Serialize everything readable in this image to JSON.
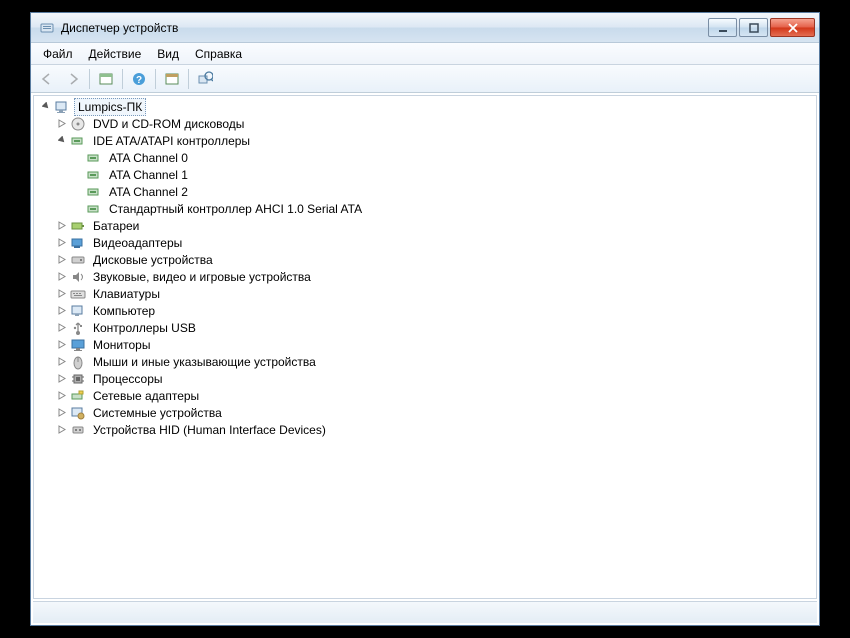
{
  "window": {
    "title": "Диспетчер устройств"
  },
  "menu": {
    "file": "Файл",
    "action": "Действие",
    "view": "Вид",
    "help": "Справка"
  },
  "tree": {
    "root": "Lumpics-ПК",
    "dvd": "DVD и CD-ROM дисководы",
    "ide": "IDE ATA/ATAPI контроллеры",
    "ide_children": {
      "ch0": "ATA Channel 0",
      "ch1": "ATA Channel 1",
      "ch2": "ATA Channel 2",
      "ahci": "Стандартный контроллер AHCI 1.0 Serial ATA"
    },
    "battery": "Батареи",
    "video": "Видеоадаптеры",
    "disk": "Дисковые устройства",
    "sound": "Звуковые, видео и игровые устройства",
    "keyboard": "Клавиатуры",
    "computer": "Компьютер",
    "usb": "Контроллеры USB",
    "monitor": "Мониторы",
    "mouse": "Мыши и иные указывающие устройства",
    "cpu": "Процессоры",
    "network": "Сетевые адаптеры",
    "system": "Системные устройства",
    "hid": "Устройства HID (Human Interface Devices)"
  }
}
